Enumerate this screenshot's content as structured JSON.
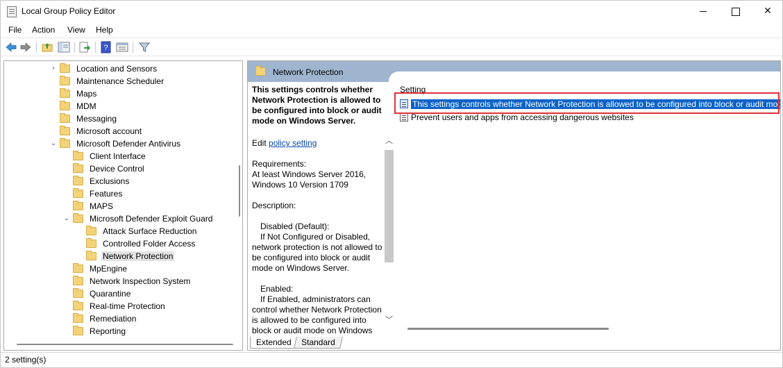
{
  "window": {
    "title": "Local Group Policy Editor"
  },
  "menu": [
    "File",
    "Action",
    "View",
    "Help"
  ],
  "toolbar": {
    "buttons": [
      "back-arrow-icon",
      "forward-arrow-icon",
      "up-folder-icon",
      "show-hide-tree-icon",
      "export-list-icon",
      "help-icon",
      "properties-icon",
      "filter-icon"
    ]
  },
  "tree": {
    "items": [
      {
        "label": "Location and Sensors",
        "indent": 0,
        "expand": "collapsed"
      },
      {
        "label": "Maintenance Scheduler",
        "indent": 0,
        "expand": "none"
      },
      {
        "label": "Maps",
        "indent": 0,
        "expand": "none"
      },
      {
        "label": "MDM",
        "indent": 0,
        "expand": "none"
      },
      {
        "label": "Messaging",
        "indent": 0,
        "expand": "none"
      },
      {
        "label": "Microsoft account",
        "indent": 0,
        "expand": "none"
      },
      {
        "label": "Microsoft Defender Antivirus",
        "indent": 0,
        "expand": "expanded"
      },
      {
        "label": "Client Interface",
        "indent": 1,
        "expand": "none"
      },
      {
        "label": "Device Control",
        "indent": 1,
        "expand": "none"
      },
      {
        "label": "Exclusions",
        "indent": 1,
        "expand": "none"
      },
      {
        "label": "Features",
        "indent": 1,
        "expand": "none"
      },
      {
        "label": "MAPS",
        "indent": 1,
        "expand": "none"
      },
      {
        "label": "Microsoft Defender Exploit Guard",
        "indent": 1,
        "expand": "expanded"
      },
      {
        "label": "Attack Surface Reduction",
        "indent": 2,
        "expand": "none"
      },
      {
        "label": "Controlled Folder Access",
        "indent": 2,
        "expand": "none"
      },
      {
        "label": "Network Protection",
        "indent": 2,
        "expand": "none",
        "selected": true
      },
      {
        "label": "MpEngine",
        "indent": 1,
        "expand": "none"
      },
      {
        "label": "Network Inspection System",
        "indent": 1,
        "expand": "none"
      },
      {
        "label": "Quarantine",
        "indent": 1,
        "expand": "none"
      },
      {
        "label": "Real-time Protection",
        "indent": 1,
        "expand": "none"
      },
      {
        "label": "Remediation",
        "indent": 1,
        "expand": "none"
      },
      {
        "label": "Reporting",
        "indent": 1,
        "expand": "none"
      }
    ]
  },
  "right_pane": {
    "header_title": "Network Protection",
    "description": {
      "setting_title": "This settings controls whether Network Protection is allowed to be configured into block or audit mode on Windows Server.",
      "edit_prefix": "Edit",
      "edit_link": "policy setting",
      "requirements_label": "Requirements:",
      "requirements_text": "At least Windows Server 2016, Windows 10 Version 1709",
      "description_label": "Description:",
      "disabled_heading": "Disabled (Default):",
      "disabled_text": "If Not Configured or Disabled, network protection is not allowed to be configured into block or audit mode on Windows Server.",
      "enabled_heading": "Enabled:",
      "enabled_text": "If Enabled, administrators can control whether Network Protection is allowed to be configured into block or audit mode on Windows Server."
    },
    "column_header": "Setting",
    "settings": [
      {
        "label": "This settings controls whether Network Protection is allowed to be configured into block or audit mode on Windows Server.",
        "selected": true
      },
      {
        "label": "Prevent users and apps from accessing dangerous websites",
        "selected": false
      }
    ],
    "tabs": [
      "Extended",
      "Standard"
    ]
  },
  "status": {
    "text": "2 setting(s)"
  },
  "colors": {
    "selection": "#0b63c9",
    "highlight_box": "#e0303a",
    "pane_header": "#9fb5cf"
  }
}
